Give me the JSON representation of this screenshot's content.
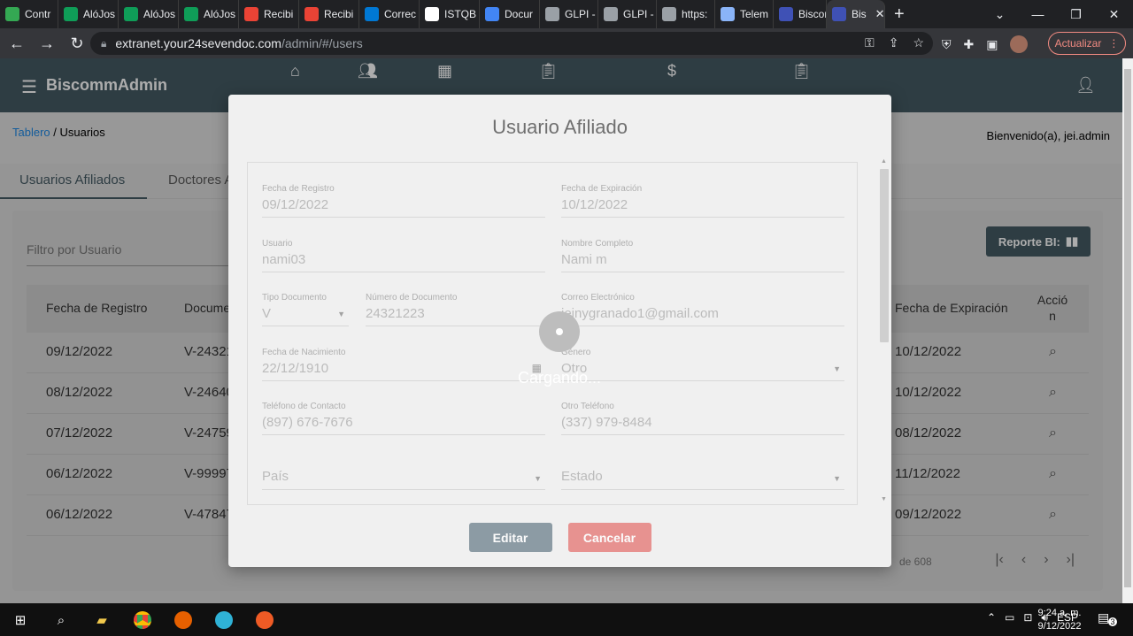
{
  "browser": {
    "tabs": [
      {
        "label": "Contr",
        "icon": "google-drive-icon",
        "color": "#34a853"
      },
      {
        "label": "AlóJos",
        "icon": "sheets-icon",
        "color": "#0f9d58"
      },
      {
        "label": "AlóJos",
        "icon": "sheets-icon",
        "color": "#0f9d58"
      },
      {
        "label": "AlóJos",
        "icon": "sheets-icon",
        "color": "#0f9d58"
      },
      {
        "label": "Recibi",
        "icon": "gmail-icon",
        "color": "#ea4335"
      },
      {
        "label": "Recibi",
        "icon": "gmail-icon",
        "color": "#ea4335"
      },
      {
        "label": "Correc",
        "icon": "outlook-icon",
        "color": "#0078d4"
      },
      {
        "label": "ISTQB",
        "icon": "istqb-icon",
        "color": "#ffffff"
      },
      {
        "label": "Docur",
        "icon": "docs-icon",
        "color": "#4285f4"
      },
      {
        "label": "GLPI -",
        "icon": "glpi-icon",
        "color": "#9aa0a6"
      },
      {
        "label": "GLPI -",
        "icon": "glpi-icon",
        "color": "#9aa0a6"
      },
      {
        "label": "https:",
        "icon": "globe-icon",
        "color": "#9aa0a6"
      },
      {
        "label": "Telem",
        "icon": "telemetry-icon",
        "color": "#8ab4f8"
      },
      {
        "label": "Biscor",
        "icon": "biscomm-icon",
        "color": "#3f51b5"
      },
      {
        "label": "Bis",
        "icon": "biscomm-icon",
        "color": "#3f51b5",
        "active": true
      }
    ],
    "url_host": "extranet.your24sevendoc.com",
    "url_path": "/admin/#/users",
    "update_label": "Actualizar"
  },
  "app": {
    "brand": "BiscommAdmin",
    "breadcrumb_root": "Tablero",
    "breadcrumb_sep": " / ",
    "breadcrumb_current": "Usuarios",
    "welcome": "Bienvenido(a), jei.admin",
    "tabs": [
      "Usuarios Afiliados",
      "Doctores A"
    ],
    "filter_placeholder": "Filtro por Usuario",
    "report_label": "Reporte BI:",
    "columns": {
      "fecha_registro": "Fecha de Registro",
      "documento": "Docume",
      "fecha_expiracion": "Fecha de Expiración",
      "accion_1": "Acció",
      "accion_2": "n"
    },
    "rows": [
      {
        "fecha": "09/12/2022",
        "doc": "V-24321",
        "exp": "10/12/2022"
      },
      {
        "fecha": "08/12/2022",
        "doc": "V-24640",
        "exp": "10/12/2022"
      },
      {
        "fecha": "07/12/2022",
        "doc": "V-24759",
        "exp": "08/12/2022"
      },
      {
        "fecha": "06/12/2022",
        "doc": "V-99997",
        "exp": "11/12/2022"
      },
      {
        "fecha": "06/12/2022",
        "doc": "V-47847",
        "exp": "09/12/2022"
      }
    ],
    "pager_info": "de 608"
  },
  "modal": {
    "title": "Usuario Afiliado",
    "fields": {
      "fecha_registro": {
        "label": "Fecha de Registro",
        "value": "09/12/2022"
      },
      "fecha_expiracion": {
        "label": "Fecha de Expiración",
        "value": "10/12/2022"
      },
      "usuario": {
        "label": "Usuario",
        "value": "nami03"
      },
      "nombre": {
        "label": "Nombre Completo",
        "value": "Nami m"
      },
      "tipo_doc": {
        "label": "Tipo Documento",
        "value": "V"
      },
      "num_doc": {
        "label": "Número de Documento",
        "value": "24321223"
      },
      "correo": {
        "label": "Correo Electrónico",
        "value": "jeinygranado1@gmail.com"
      },
      "fecha_nac": {
        "label": "Fecha de Nacimiento",
        "value": "22/12/1910"
      },
      "genero": {
        "label": "Género",
        "value": "Otro"
      },
      "telefono": {
        "label": "Teléfono de Contacto",
        "value": "(897) 676-7676"
      },
      "otro_tel": {
        "label": "Otro Teléfono",
        "value": "(337) 979-8484"
      },
      "pais": {
        "label": "",
        "value": "País"
      },
      "estado": {
        "label": "",
        "value": "Estado"
      }
    },
    "edit_label": "Editar",
    "cancel_label": "Cancelar",
    "loading_text": "Cargando..."
  },
  "taskbar": {
    "lang": "ESP",
    "time": "9:24 a. m.",
    "date": "9/12/2022",
    "notifications": "3"
  },
  "colors": {
    "appbar": "#455a64",
    "cancel": "#e57370",
    "edit": "#6b7f8b",
    "link": "#1e88e5"
  }
}
